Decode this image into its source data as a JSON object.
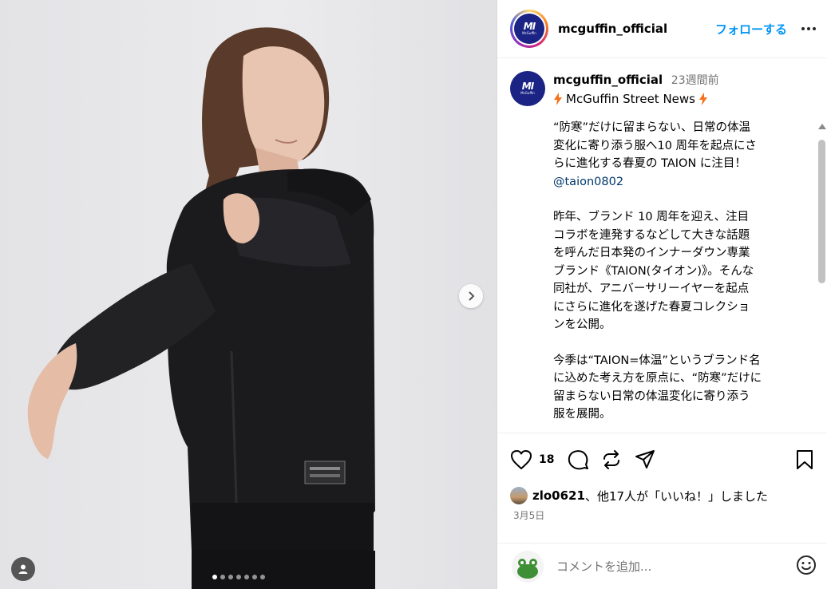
{
  "post": {
    "username": "mcguffin_official",
    "follow_label": "フォローする",
    "logo_mark": "MI",
    "logo_sub": "McGuffin"
  },
  "caption": {
    "username": "mcguffin_official",
    "time": "23週間前",
    "title": "McGuffin Street News",
    "para1_lines": [
      "“防寒”だけに留まらない、日常の体温",
      "変化に寄り添う服へ10 周年を起点にさ",
      "らに進化する春夏の TAION に注目！"
    ],
    "mention": "@taion0802",
    "para2_lines": [
      "昨年、ブランド 10 周年を迎え、注目",
      "コラボを連発するなどして大きな話題",
      "を呼んだ日本発のインナーダウン専業",
      "ブランド《TAION(タイオン)》。そんな",
      "同社が、アニバーサリーイヤーを起点",
      "にさらに進化を遂げた春夏コレクショ",
      "ンを公開。"
    ],
    "para3_lines": [
      "今季は“TAION=体温”というブランド名",
      "に込めた考え方を原点に、“防寒”だけに",
      "留まらない日常の体温変化に寄り添う",
      "服を展開。"
    ]
  },
  "actions": {
    "like_count": "18",
    "icons": [
      "heart-icon",
      "comment-icon",
      "share-icon",
      "send-icon",
      "bookmark-icon"
    ]
  },
  "likes": {
    "user": "zlo0621",
    "rest": "、他17人が「いいね！」しました"
  },
  "date": "3月5日",
  "comment": {
    "placeholder": "コメントを追加..."
  },
  "carousel": {
    "total": 7,
    "active_index": 0
  },
  "colors": {
    "accent": "#0095f6",
    "brand": "#1b2384",
    "muted": "#737373"
  }
}
